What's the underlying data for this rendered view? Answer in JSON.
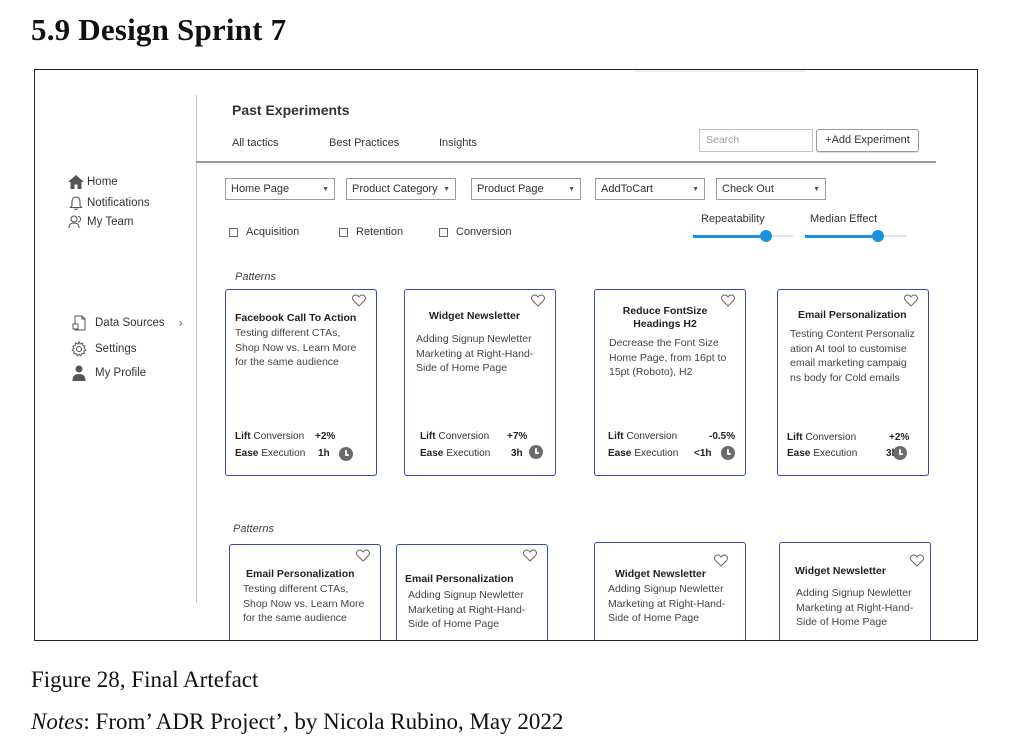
{
  "doc": {
    "heading": "5.9 Design Sprint 7",
    "caption": "Figure 28, Final Artefact",
    "notes_label": "Notes",
    "notes_text": ": From’ ADR Project’, by Nicola Rubino, May 2022"
  },
  "sidebar": {
    "items": [
      {
        "label": "Home",
        "icon": "home-icon"
      },
      {
        "label": "Notifications",
        "icon": "bell-icon"
      },
      {
        "label": "My Team",
        "icon": "team-icon"
      },
      {
        "label": "Data Sources",
        "icon": "data-sources-icon"
      },
      {
        "label": "Settings",
        "icon": "gear-icon"
      },
      {
        "label": "My Profile",
        "icon": "person-icon"
      }
    ]
  },
  "header": {
    "title": "Past Experiments",
    "tabs": [
      "All tactics",
      "Best Practices",
      "Insights"
    ],
    "search_placeholder": "Search",
    "add_button": "+Add Experiment"
  },
  "filters": {
    "dropdowns": [
      "Home Page",
      "Product Category",
      "Product Page",
      "AddToCart",
      "Check Out"
    ],
    "checkboxes": [
      "Acquisition",
      "Retention",
      "Conversion"
    ],
    "sliders": [
      {
        "label": "Repeatability",
        "value_fraction": 0.73
      },
      {
        "label": "Median Effect",
        "value_fraction": 0.72
      }
    ]
  },
  "sections": [
    {
      "label": "Patterns",
      "cards": [
        {
          "title": "Facebook Call To Action",
          "desc": [
            "Testing different CTAs,",
            "Shop Now vs. Learn More",
            "for the same audience"
          ],
          "lift_label": "Lift",
          "lift_metric": "Conversion",
          "lift_value": "+2%",
          "ease_label": "Ease",
          "ease_metric": "Execution",
          "ease_value": "1h"
        },
        {
          "title": "Widget Newsletter",
          "desc": [
            "Adding Signup Newletter",
            "Marketing at Right-Hand-",
            "Side of Home Page"
          ],
          "lift_label": "Lift",
          "lift_metric": "Conversion",
          "lift_value": "+7%",
          "ease_label": "Ease",
          "ease_metric": "Execution",
          "ease_value": "3h"
        },
        {
          "title": "Reduce FontSize Headings H2",
          "desc": [
            "Decrease the Font Size",
            "Home Page, from 16pt to",
            "15pt (Roboto), H2"
          ],
          "lift_label": "Lift",
          "lift_metric": "Conversion",
          "lift_value": "-0.5%",
          "ease_label": "Ease",
          "ease_metric": "Execution",
          "ease_value": "<1h"
        },
        {
          "title": "Email Personalization",
          "desc": [
            "Testing Content Personaliz",
            "ation AI tool to customise",
            "email marketing campaig",
            "ns body for Cold emails"
          ],
          "lift_label": "Lift",
          "lift_metric": "Conversion",
          "lift_value": "+2%",
          "ease_label": "Ease",
          "ease_metric": "Execution",
          "ease_value": "3h"
        }
      ]
    },
    {
      "label": "Patterns",
      "cards": [
        {
          "title": "Email Personalization",
          "desc": [
            "Testing different CTAs,",
            "Shop Now vs. Learn More",
            "for the same audience"
          ]
        },
        {
          "title": "Email Personalization",
          "desc": [
            "Adding Signup Newletter",
            "Marketing at Right-Hand-",
            "Side of Home Page"
          ]
        },
        {
          "title": "Widget Newsletter",
          "desc": [
            "Adding Signup Newletter",
            "Marketing at Right-Hand-",
            "Side of Home Page"
          ]
        },
        {
          "title": "Widget Newsletter",
          "desc": [
            "Adding Signup Newletter",
            "Marketing at Right-Hand-",
            "Side of Home Page"
          ]
        }
      ]
    }
  ]
}
